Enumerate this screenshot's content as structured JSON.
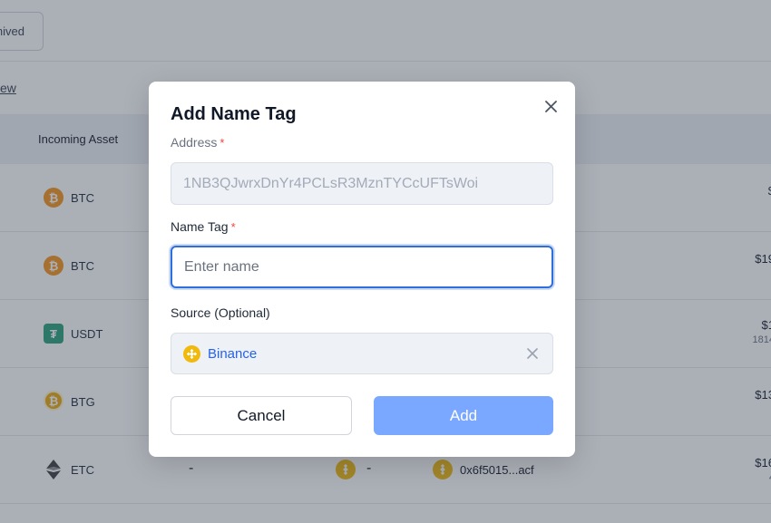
{
  "background": {
    "tab_label": "hived",
    "view_link": "ew",
    "column_header": "Incoming Asset",
    "rows": [
      {
        "symbol": "BTC",
        "icon": "bitcoin-icon",
        "amount": "$",
        "sub": ""
      },
      {
        "symbol": "BTC",
        "icon": "bitcoin-icon",
        "amount": "$19",
        "sub": ""
      },
      {
        "symbol": "USDT",
        "icon": "tether-icon",
        "amount": "$1",
        "sub": "1814"
      },
      {
        "symbol": "BTG",
        "icon": "bitcoin-gold-icon",
        "amount": "$13",
        "sub": ""
      },
      {
        "symbol": "ETC",
        "icon": "ethereum-classic-icon",
        "amount": "$16",
        "sub": "4",
        "dash1": "-",
        "dash2": "-",
        "address": "0x6f5015...acf"
      }
    ]
  },
  "modal": {
    "title": "Add Name Tag",
    "address_label": "Address",
    "address_value": "1NB3QJwrxDnYr4PCLsR3MznTYCcUFTsWoi",
    "name_tag_label": "Name Tag",
    "name_tag_placeholder": "Enter name",
    "name_tag_value": "",
    "source_label": "Source (Optional)",
    "source_value": "Binance",
    "required_mark": "*",
    "cancel_label": "Cancel",
    "add_label": "Add"
  },
  "colors": {
    "primary": "#2f6fdb",
    "add_button": "#7aa7ff",
    "required": "#ef4444",
    "binance": "#f0b90b"
  }
}
